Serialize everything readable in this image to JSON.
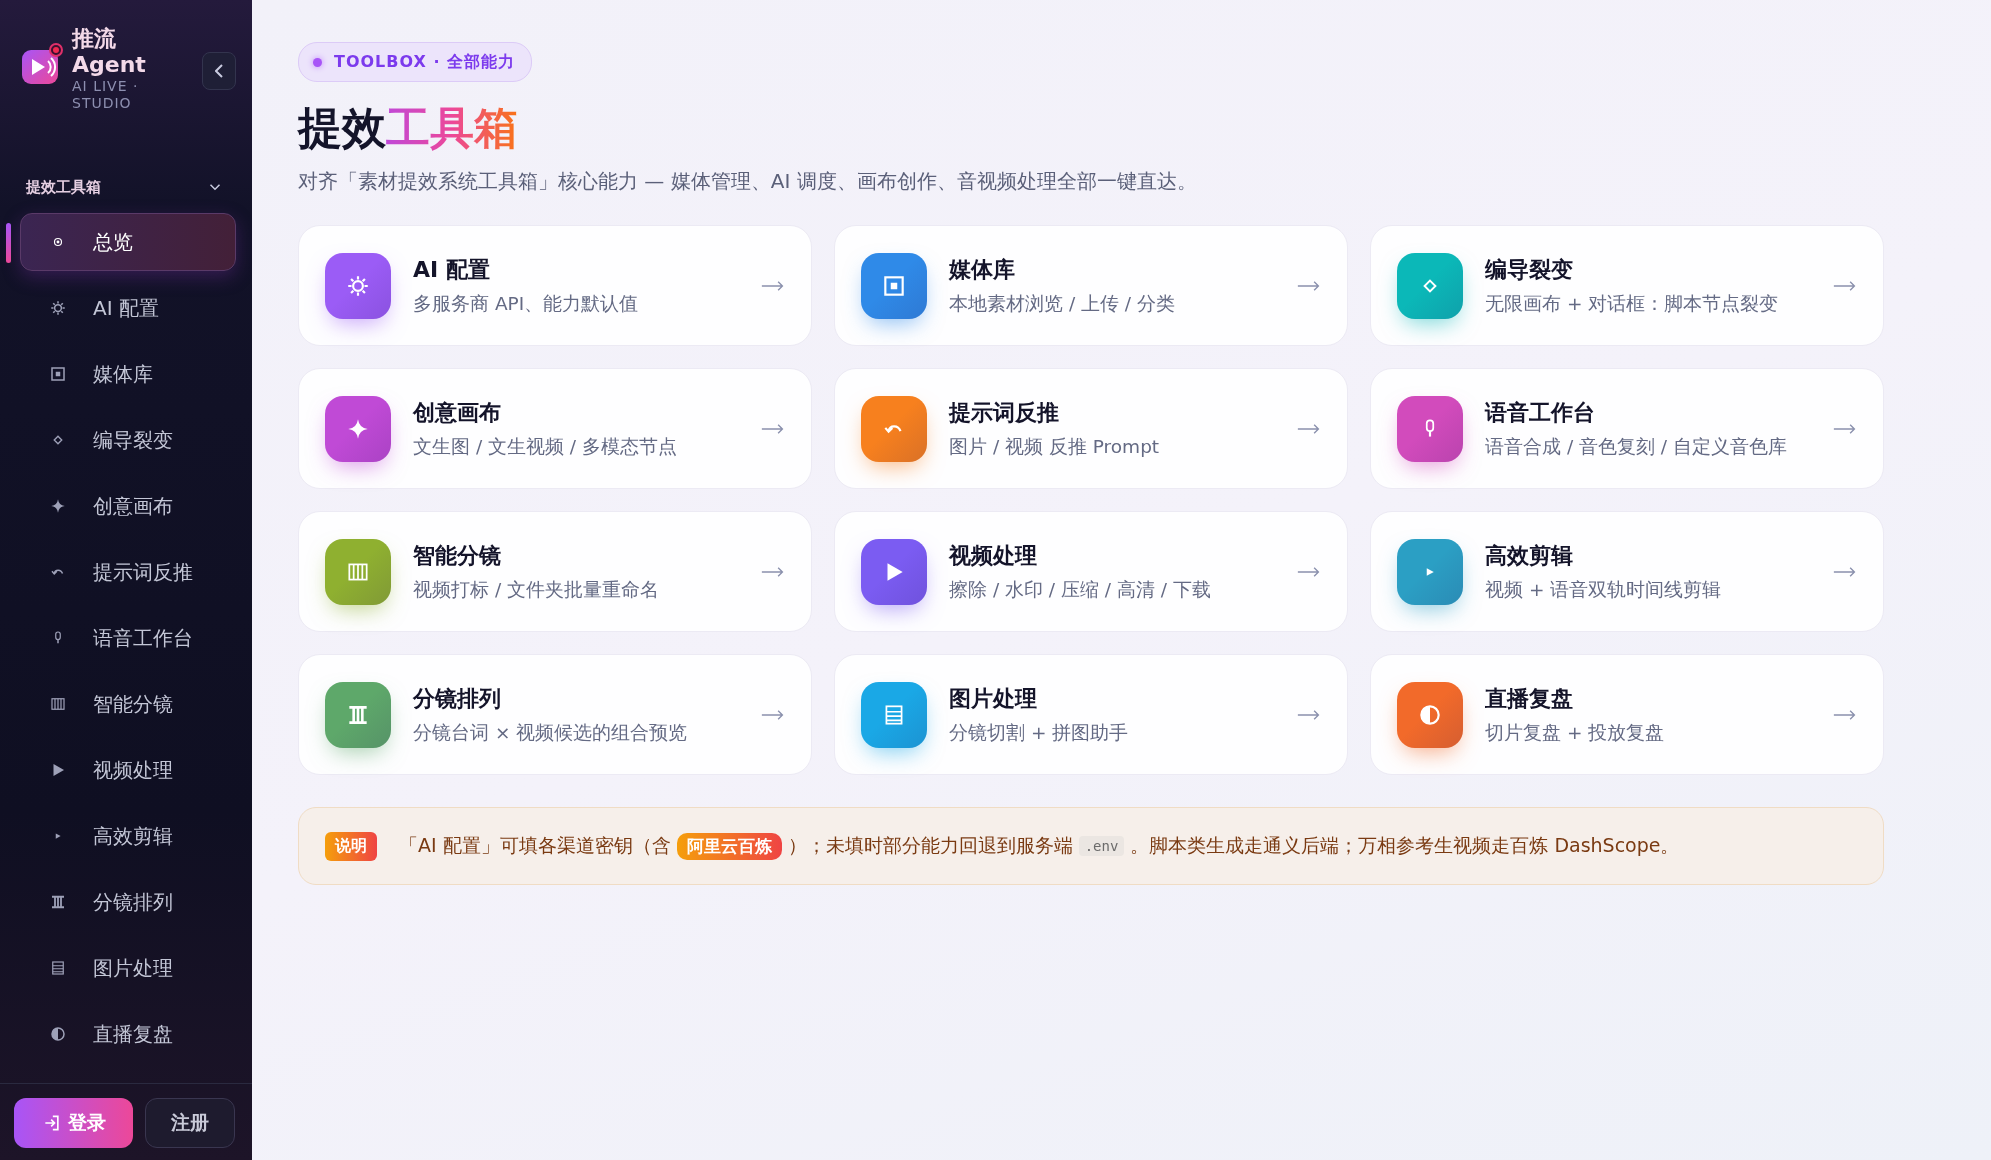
{
  "brand": {
    "name": "推流",
    "name2": "Agent",
    "tagline": "AI LIVE · STUDIO"
  },
  "sidebar": {
    "section": {
      "label": "提效工具箱",
      "expanded": true
    },
    "items": [
      {
        "label": "总览",
        "kind": "overview",
        "selected": true
      },
      {
        "label": "AI 配置",
        "kind": "gear",
        "selected": false
      },
      {
        "label": "媒体库",
        "kind": "media",
        "selected": false
      },
      {
        "label": "编导裂变",
        "kind": "diamond",
        "selected": false
      },
      {
        "label": "创意画布",
        "kind": "sparkle",
        "selected": false
      },
      {
        "label": "提示词反推",
        "kind": "undo",
        "selected": false
      },
      {
        "label": "语音工作台",
        "kind": "mic",
        "selected": false
      },
      {
        "label": "智能分镜",
        "kind": "columns",
        "selected": false
      },
      {
        "label": "视频处理",
        "kind": "play",
        "selected": false
      },
      {
        "label": "高效剪辑",
        "kind": "smallplay",
        "selected": false
      },
      {
        "label": "分镜排列",
        "kind": "three",
        "selected": false
      },
      {
        "label": "图片处理",
        "kind": "list",
        "selected": false
      },
      {
        "label": "直播复盘",
        "kind": "half",
        "selected": false
      }
    ],
    "buttons": [
      {
        "label": "登录",
        "kind": "primary"
      },
      {
        "label": "注册",
        "kind": "secondary"
      }
    ]
  },
  "header": {
    "badge": "TOOLBOX · 全部能力",
    "title": "提效",
    "title_accent": "工具箱",
    "subtitle": "对齐「素材提效系统工具箱」核心能力 — 媒体管理、AI 调度、画布创作、音视频处理全部一键直达。"
  },
  "cards": [
    {
      "title": "AI 配置",
      "description": "多服务商 API、能力默认值",
      "kind": "gear",
      "color": "#9b5cf6"
    },
    {
      "title": "媒体库",
      "description": "本地素材浏览 / 上传 / 分类",
      "kind": "media",
      "color": "#2f8ae8"
    },
    {
      "title": "编导裂变",
      "description": "无限画布 + 对话框：脚本节点裂变",
      "kind": "diamond",
      "color": "#0bb8b8"
    },
    {
      "title": "创意画布",
      "description": "文生图 / 文生视频 / 多模态节点",
      "kind": "sparkle",
      "color": "#c04ad6"
    },
    {
      "title": "提示词反推",
      "description": "图片 / 视频 反推 Prompt",
      "kind": "undo",
      "color": "#f7801e"
    },
    {
      "title": "语音工作台",
      "description": "语音合成 / 音色复刻 / 自定义音色库",
      "kind": "mic",
      "color": "#d24bbc"
    },
    {
      "title": "智能分镜",
      "description": "视频打标 / 文件夹批量重命名",
      "kind": "columns",
      "color": "#8fb030"
    },
    {
      "title": "视频处理",
      "description": "擦除 / 水印 / 压缩 / 高清 / 下载",
      "kind": "play",
      "color": "#7b5cf2"
    },
    {
      "title": "高效剪辑",
      "description": "视频 + 语音双轨时间线剪辑",
      "kind": "smallplay",
      "color": "#2b9fc4"
    },
    {
      "title": "分镜排列",
      "description": "分镜台词 × 视频候选的组合预览",
      "kind": "three",
      "color": "#5ea86a"
    },
    {
      "title": "图片处理",
      "description": "分镜切割 + 拼图助手",
      "kind": "list",
      "color": "#1aa8e6"
    },
    {
      "title": "直播复盘",
      "description": "切片复盘 + 投放复盘",
      "kind": "half",
      "color": "#f26a2a"
    }
  ],
  "note": {
    "label": "说明",
    "parts": [
      {
        "kind": "text",
        "text": "「AI 配置」可填各渠道密钥（含"
      },
      {
        "kind": "tag",
        "text": "阿里云百炼"
      },
      {
        "kind": "text",
        "text": "）；未填时部分能力回退到服务端"
      },
      {
        "kind": "code",
        "text": ".env"
      },
      {
        "kind": "text",
        "text": "。脚本类生成走通义后端；万相参考生视频走百炼 DashScope。"
      }
    ]
  }
}
